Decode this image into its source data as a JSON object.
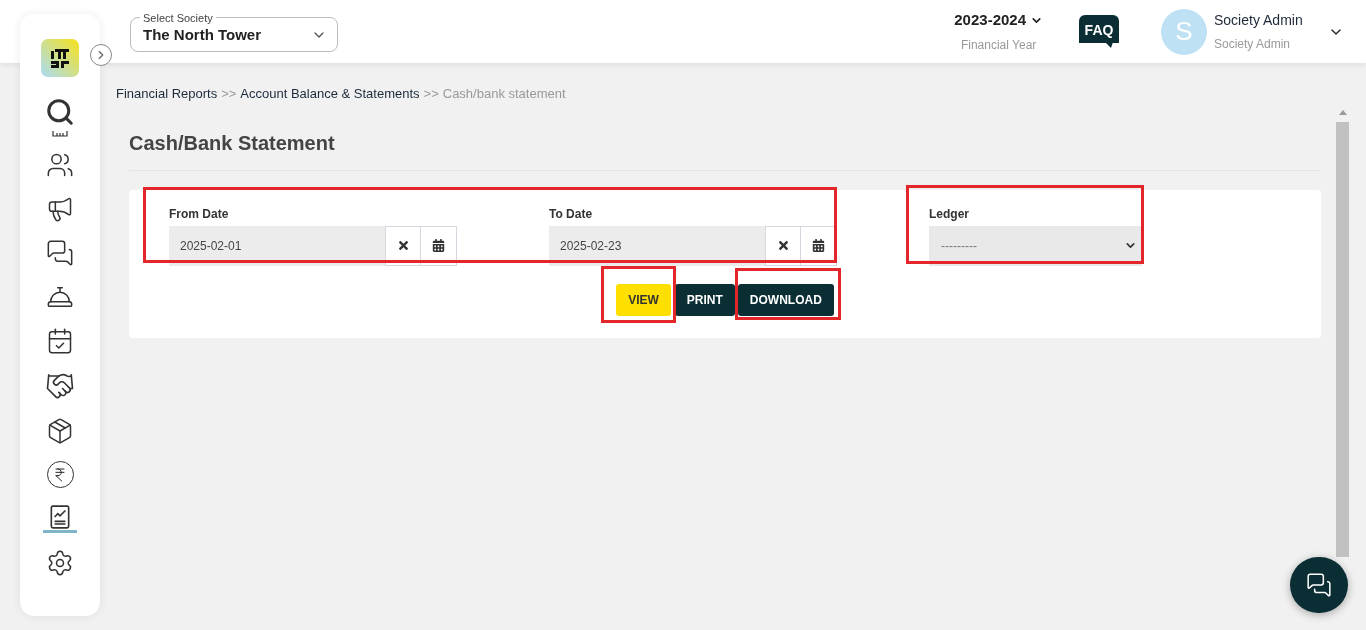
{
  "sidebar": {
    "items": [
      {
        "selected": false
      },
      {
        "selected": false
      },
      {
        "selected": false
      },
      {
        "selected": false
      },
      {
        "selected": false
      },
      {
        "selected": false
      },
      {
        "selected": false
      },
      {
        "selected": false
      },
      {
        "selected": true
      },
      {
        "selected": false
      }
    ]
  },
  "header": {
    "society_select": {
      "label": "Select Society",
      "value": "The North Tower"
    },
    "year": {
      "value": "2023-2024",
      "caption": "Financial Year"
    },
    "faq": "FAQ",
    "user": {
      "initial": "S",
      "name": "Society Admin",
      "role": "Society Admin"
    }
  },
  "breadcrumb": [
    {
      "kind": "link",
      "label": "Financial Reports"
    },
    {
      "kind": "separator",
      "label": ">>"
    },
    {
      "kind": "link",
      "label": "Account Balance & Statements"
    },
    {
      "kind": "separator",
      "label": ">>"
    },
    {
      "kind": "current",
      "label": "Cash/bank statement"
    }
  ],
  "page_title": "Cash/Bank Statement",
  "form": {
    "fields": [
      {
        "kind": "date",
        "label": "From Date",
        "value": "2025-02-01"
      },
      {
        "kind": "date",
        "label": "To Date",
        "value": "2025-02-23"
      },
      {
        "kind": "select",
        "label": "Ledger",
        "placeholder": "---------"
      }
    ],
    "buttons": [
      {
        "kind": "primary",
        "label": "VIEW"
      },
      {
        "kind": "dark",
        "label": "PRINT"
      },
      {
        "kind": "dark",
        "label": "DOWNLOAD"
      }
    ]
  }
}
